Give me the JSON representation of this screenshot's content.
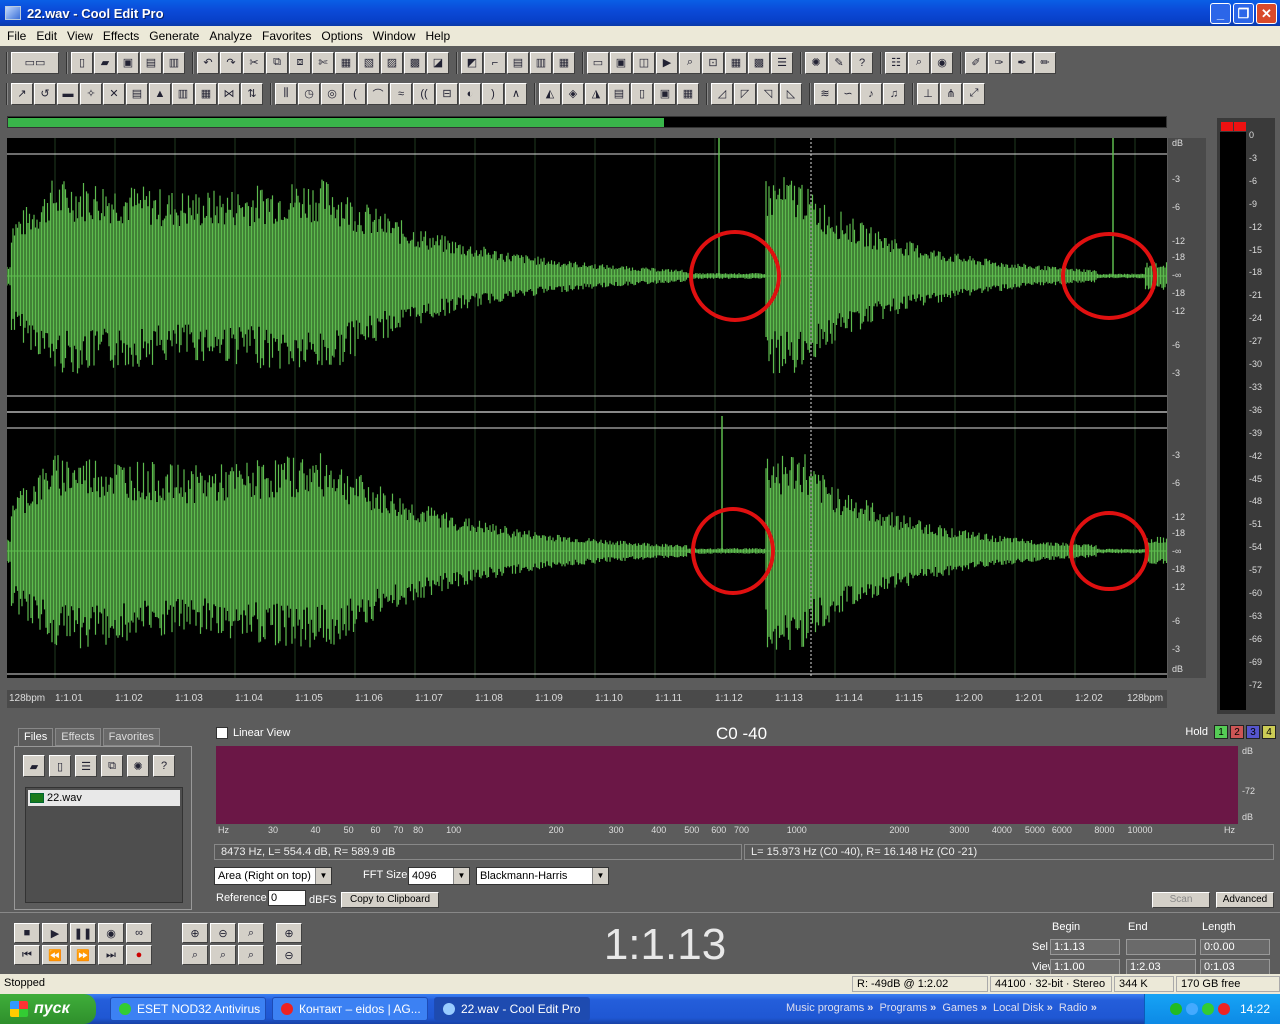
{
  "window": {
    "title": "22.wav - Cool Edit Pro"
  },
  "menu": [
    "File",
    "Edit",
    "View",
    "Effects",
    "Generate",
    "Analyze",
    "Favorites",
    "Options",
    "Window",
    "Help"
  ],
  "waveform": {
    "db_labels_top": [
      "dB",
      "-3",
      "-6",
      "-12",
      "-18",
      "-∞",
      "-18",
      "-12",
      "-6",
      "-3"
    ],
    "db_labels_bottom": [
      "-3",
      "-6",
      "-12",
      "-18",
      "-∞",
      "-18",
      "-12",
      "-6",
      "-3",
      "dB"
    ],
    "time_labels": [
      "128bpm",
      "1:1.01",
      "1:1.02",
      "1:1.03",
      "1:1.04",
      "1:1.05",
      "1:1.06",
      "1:1.07",
      "1:1.08",
      "1:1.09",
      "1:1.10",
      "1:1.11",
      "1:1.12",
      "1:1.13",
      "1:1.14",
      "1:1.15",
      "1:2.00",
      "1:2.01",
      "1:2.02",
      "128bpm"
    ],
    "wave_color": "#5dbb4e",
    "annotation_color": "#e01010"
  },
  "level_meter": {
    "labels": [
      "0",
      "-3",
      "-6",
      "-9",
      "-12",
      "-15",
      "-18",
      "-21",
      "-24",
      "-27",
      "-30",
      "-33",
      "-36",
      "-39",
      "-42",
      "-45",
      "-48",
      "-51",
      "-54",
      "-57",
      "-60",
      "-63",
      "-66",
      "-69",
      "-72"
    ]
  },
  "organizer": {
    "tabs": [
      "Files",
      "Effects",
      "Favorites"
    ],
    "files": [
      "22.wav"
    ]
  },
  "frequency": {
    "linear_view_label": "Linear View",
    "note": "C0 -40",
    "hold_label": "Hold",
    "hold_buttons": [
      "1",
      "2",
      "3",
      "4"
    ],
    "hold_colors": [
      "#5c5",
      "#c55",
      "#55c",
      "#cc5"
    ],
    "db_labels": [
      "dB",
      "-72",
      "dB"
    ],
    "axis_labels": [
      "Hz",
      "30",
      "40",
      "50",
      "60",
      "70",
      "80",
      "100",
      "200",
      "300",
      "400",
      "500",
      "600",
      "700",
      "1000",
      "2000",
      "3000",
      "4000",
      "5000",
      "6000",
      "8000",
      "10000",
      "Hz"
    ],
    "readout_left": "8473 Hz, L= 554.4 dB, R= 589.9 dB",
    "readout_right": "L= 15.973 Hz (C0 -40), R= 16.148 Hz (C0 -21)",
    "area_mode": "Area (Right on top)",
    "fft_label": "FFT Size",
    "fft_size": "4096",
    "window_fn": "Blackmann-Harris",
    "reference_label": "Reference",
    "reference_value": "0",
    "dbfs_label": "dBFS",
    "copy_label": "Copy to Clipboard",
    "scan_label": "Scan",
    "advanced_label": "Advanced"
  },
  "transport": {
    "time": "1:1.13",
    "headers": [
      "Begin",
      "End",
      "Length"
    ],
    "sel_label": "Sel",
    "view_label": "View",
    "sel": [
      "1:1.13",
      "",
      "0:0.00"
    ],
    "view": [
      "1:1.00",
      "1:2.03",
      "0:1.03"
    ]
  },
  "status": {
    "state": "Stopped",
    "cursor": "R: -49dB @ 1:2.02",
    "format": "44100 · 32-bit · Stereo",
    "size": "344 K",
    "free": "170 GB free"
  },
  "taskbar": {
    "start_label": "пуск",
    "tasks": [
      {
        "label": "ESET NOD32 Antivirus",
        "color": "#3c3"
      },
      {
        "label": "Контакт – eidos | AG...",
        "color": "#e22"
      },
      {
        "label": "22.wav - Cool Edit Pro",
        "color": "#9cf"
      }
    ],
    "quick_links": [
      "Music programs",
      "Programs",
      "Games",
      "Local Disk",
      "Radio"
    ],
    "clock": "14:22"
  }
}
